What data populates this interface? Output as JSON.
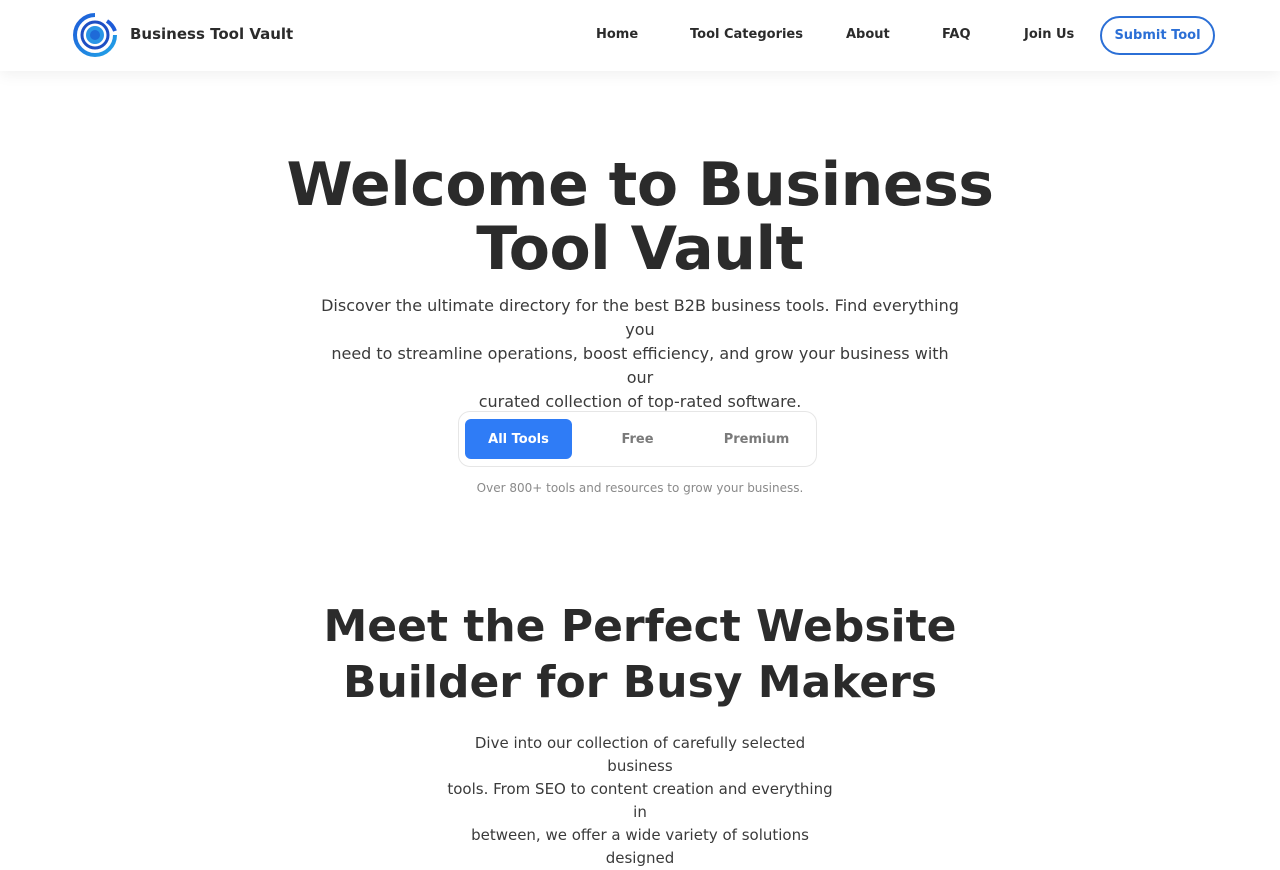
{
  "header": {
    "brand": "Business Tool Vault",
    "logo_icon": "concentric-circles-logo",
    "nav": [
      "Home",
      "Tool Categories",
      "About",
      "FAQ",
      "Join Us"
    ],
    "submit_label": "Submit Tool"
  },
  "hero": {
    "title_line1": "Welcome to Business",
    "title_line2": "Tool Vault",
    "description_line1": "Discover the ultimate directory for the best B2B business tools. Find everything you",
    "description_line2": "need to streamline operations, boost efficiency, and grow your business with our",
    "description_line3": "curated collection of top-rated software.",
    "filters": [
      "All Tools",
      "Free",
      "Premium"
    ],
    "active_filter": "All Tools",
    "tool_count_text": "Over 800+ tools and resources to grow your business."
  },
  "section": {
    "title_line1": "Meet the Perfect Website",
    "title_line2": "Builder for Busy Makers",
    "description_line1": "Dive into our collection of carefully selected business",
    "description_line2": "tools. From SEO to content creation and everything in",
    "description_line3": "between, we offer a wide variety of solutions designed"
  },
  "colors": {
    "accent": "#2f7cf6",
    "button_outline": "#2b6fd6",
    "text": "#2b2b2b"
  }
}
